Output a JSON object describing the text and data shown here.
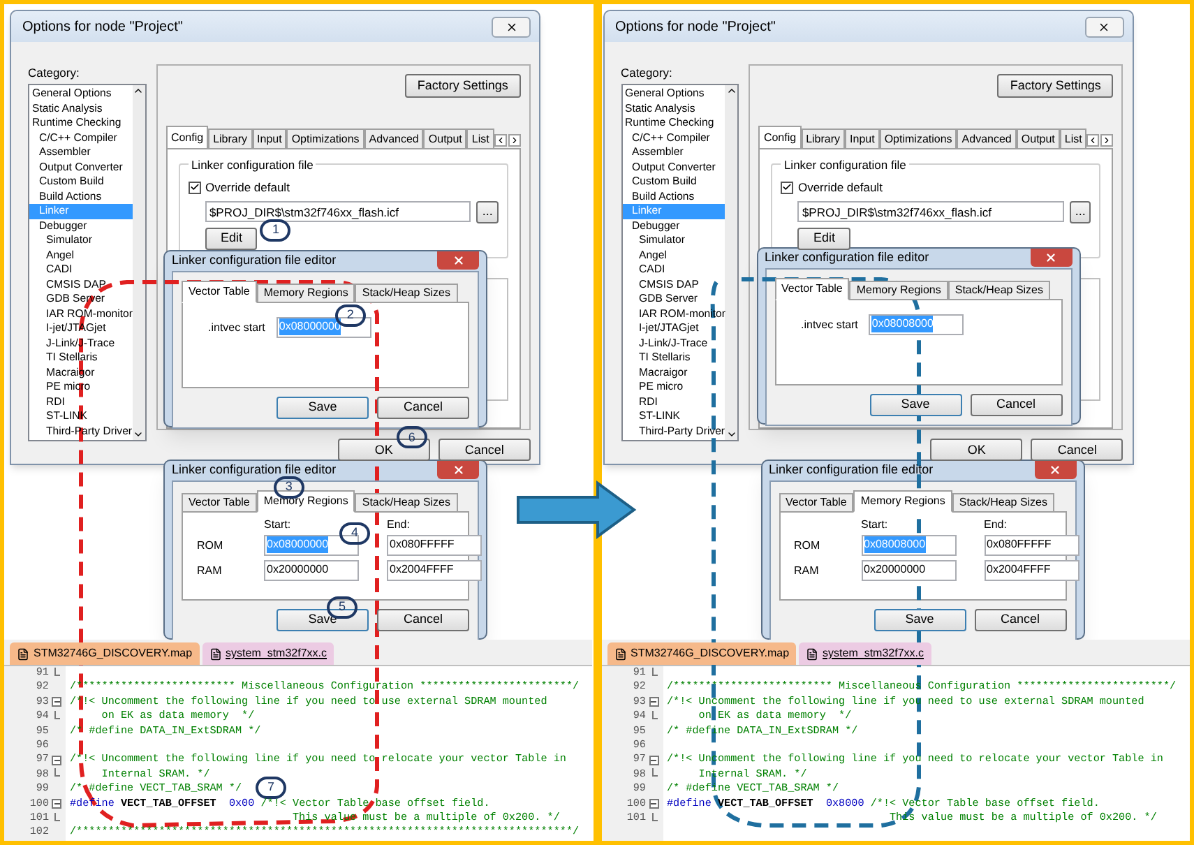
{
  "panels": [
    {
      "options_dialog": {
        "title": "Options for node \"Project\"",
        "category_label": "Category:",
        "categories": [
          {
            "label": "General Options",
            "selected": false
          },
          {
            "label": "Static Analysis",
            "selected": false
          },
          {
            "label": "Runtime Checking",
            "selected": false,
            "children": [
              {
                "label": "C/C++ Compiler",
                "selected": false
              },
              {
                "label": "Assembler",
                "selected": false
              },
              {
                "label": "Output Converter",
                "selected": false
              },
              {
                "label": "Custom Build",
                "selected": false
              },
              {
                "label": "Build Actions",
                "selected": false
              },
              {
                "label": "Linker",
                "selected": true
              },
              {
                "label": "Debugger",
                "selected": false,
                "children": [
                  {
                    "label": "Simulator",
                    "selected": false
                  },
                  {
                    "label": "Angel",
                    "selected": false
                  },
                  {
                    "label": "CADI",
                    "selected": false
                  },
                  {
                    "label": "CMSIS DAP",
                    "selected": false
                  },
                  {
                    "label": "GDB Server",
                    "selected": false
                  },
                  {
                    "label": "IAR ROM-monitor",
                    "selected": false
                  },
                  {
                    "label": "I-jet/JTAGjet",
                    "selected": false
                  },
                  {
                    "label": "J-Link/J-Trace",
                    "selected": false
                  },
                  {
                    "label": "TI Stellaris",
                    "selected": false
                  },
                  {
                    "label": "Macraigor",
                    "selected": false
                  },
                  {
                    "label": "PE micro",
                    "selected": false
                  },
                  {
                    "label": "RDI",
                    "selected": false
                  },
                  {
                    "label": "ST-LINK",
                    "selected": false
                  },
                  {
                    "label": "Third-Party Driver",
                    "selected": false
                  }
                ]
              }
            ]
          }
        ],
        "factory_button": "Factory Settings",
        "tabs": [
          {
            "label": "Config",
            "selected": true
          },
          {
            "label": "Library",
            "selected": false
          },
          {
            "label": "Input",
            "selected": false
          },
          {
            "label": "Optimizations",
            "selected": false
          },
          {
            "label": "Advanced",
            "selected": false
          },
          {
            "label": "Output",
            "selected": false
          },
          {
            "label": "List",
            "selected": false
          }
        ],
        "group_label": "Linker configuration file",
        "override": {
          "label": "Override default",
          "checked": true
        },
        "path": "$PROJ_DIR$\\stm32f746xx_flash.icf",
        "browse_button": "...",
        "edit_button": {
          "label": "Edit",
          "callout": "1"
        },
        "ok_button": {
          "label": "OK",
          "callout": "6"
        },
        "cancel_button": {
          "label": "Cancel"
        }
      },
      "vector_editor": {
        "title": "Linker configuration file editor",
        "tabs": [
          {
            "label": "Vector Table",
            "selected": true
          },
          {
            "label": "Memory Regions",
            "selected": false
          },
          {
            "label": "Stack/Heap Sizes",
            "selected": false
          }
        ],
        "field": {
          "label": ".intvec start",
          "value": "0x08000000",
          "highlighted": true,
          "callout": "2"
        },
        "save_button": {
          "label": "Save"
        },
        "cancel_button": {
          "label": "Cancel"
        }
      },
      "memory_editor": {
        "title": "Linker configuration file editor",
        "tabs": [
          {
            "label": "Vector Table",
            "selected": false
          },
          {
            "label": "Memory Regions",
            "selected": true,
            "callout": "3"
          },
          {
            "label": "Stack/Heap Sizes",
            "selected": false
          }
        ],
        "start_label": "Start:",
        "end_label": "End:",
        "rows": [
          {
            "label": "ROM",
            "start": {
              "value": "0x08000000",
              "highlighted": true,
              "callout": "4"
            },
            "end": {
              "value": "0x080FFFFF",
              "highlighted": false
            }
          },
          {
            "label": "RAM",
            "start": {
              "value": "0x20000000",
              "highlighted": false
            },
            "end": {
              "value": "0x2004FFFF",
              "highlighted": false
            }
          }
        ],
        "save_button": {
          "label": "Save",
          "callout": "5"
        },
        "cancel_button": {
          "label": "Cancel"
        }
      },
      "code_editor": {
        "tabs": [
          {
            "label": "STM32746G_DISCOVERY.map",
            "selected": false
          },
          {
            "label": "system_stm32f7xx.c",
            "selected": true
          }
        ],
        "lines": [
          {
            "number": "91",
            "kind": "end"
          },
          {
            "number": "92",
            "kind": "plain",
            "segments": [
              {
                "kind": "comment",
                "text": "/************************* Miscellaneous Configuration ************************/"
              }
            ]
          },
          {
            "number": "93",
            "kind": "start",
            "segments": [
              {
                "kind": "comment",
                "text": "/*!< Uncomment the following line if you need to use external SDRAM mounted"
              }
            ]
          },
          {
            "number": "94",
            "kind": "end",
            "segments": [
              {
                "kind": "comment",
                "text": "     on EK as data memory  */"
              }
            ]
          },
          {
            "number": "95",
            "kind": "plain",
            "segments": [
              {
                "kind": "comment",
                "text": "/* #define DATA_IN_ExtSDRAM */"
              }
            ]
          },
          {
            "number": "96",
            "kind": "plain"
          },
          {
            "number": "97",
            "kind": "start",
            "segments": [
              {
                "kind": "comment",
                "text": "/*!< Uncomment the following line if you need to relocate your vector Table in"
              }
            ]
          },
          {
            "number": "98",
            "kind": "end",
            "segments": [
              {
                "kind": "comment",
                "text": "     Internal SRAM. */"
              }
            ]
          },
          {
            "number": "99",
            "kind": "plain",
            "callout": "7",
            "segments": [
              {
                "kind": "comment",
                "text": "/* #define VECT_TAB_SRAM */"
              }
            ]
          },
          {
            "number": "100",
            "kind": "start",
            "segments": [
              {
                "kind": "keyword",
                "text": "#define"
              },
              {
                "kind": "plain",
                "text": " VECT_TAB_OFFSET  "
              },
              {
                "kind": "number",
                "text": "0x00"
              },
              {
                "kind": "comment",
                "text": " /*!< Vector Table base offset field."
              }
            ]
          },
          {
            "number": "101",
            "kind": "end",
            "segments": [
              {
                "kind": "comment",
                "text": "                                   This value must be a multiple of 0x200. */"
              }
            ]
          },
          {
            "number": "102",
            "kind": "plain",
            "segments": [
              {
                "kind": "comment",
                "text": "/******************************************************************************/"
              }
            ]
          }
        ]
      }
    },
    {
      "options_dialog": {
        "title": "Options for node \"Project\"",
        "category_label": "Category:",
        "categories": [
          {
            "label": "General Options",
            "selected": false
          },
          {
            "label": "Static Analysis",
            "selected": false
          },
          {
            "label": "Runtime Checking",
            "selected": false,
            "children": [
              {
                "label": "C/C++ Compiler",
                "selected": false
              },
              {
                "label": "Assembler",
                "selected": false
              },
              {
                "label": "Output Converter",
                "selected": false
              },
              {
                "label": "Custom Build",
                "selected": false
              },
              {
                "label": "Build Actions",
                "selected": false
              },
              {
                "label": "Linker",
                "selected": true
              },
              {
                "label": "Debugger",
                "selected": false,
                "children": [
                  {
                    "label": "Simulator",
                    "selected": false
                  },
                  {
                    "label": "Angel",
                    "selected": false
                  },
                  {
                    "label": "CADI",
                    "selected": false
                  },
                  {
                    "label": "CMSIS DAP",
                    "selected": false
                  },
                  {
                    "label": "GDB Server",
                    "selected": false
                  },
                  {
                    "label": "IAR ROM-monitor",
                    "selected": false
                  },
                  {
                    "label": "I-jet/JTAGjet",
                    "selected": false
                  },
                  {
                    "label": "J-Link/J-Trace",
                    "selected": false
                  },
                  {
                    "label": "TI Stellaris",
                    "selected": false
                  },
                  {
                    "label": "Macraigor",
                    "selected": false
                  },
                  {
                    "label": "PE micro",
                    "selected": false
                  },
                  {
                    "label": "RDI",
                    "selected": false
                  },
                  {
                    "label": "ST-LINK",
                    "selected": false
                  },
                  {
                    "label": "Third-Party Driver",
                    "selected": false
                  }
                ]
              }
            ]
          }
        ],
        "factory_button": "Factory Settings",
        "tabs": [
          {
            "label": "Config",
            "selected": true
          },
          {
            "label": "Library",
            "selected": false
          },
          {
            "label": "Input",
            "selected": false
          },
          {
            "label": "Optimizations",
            "selected": false
          },
          {
            "label": "Advanced",
            "selected": false
          },
          {
            "label": "Output",
            "selected": false
          },
          {
            "label": "List",
            "selected": false
          }
        ],
        "group_label": "Linker configuration file",
        "override": {
          "label": "Override default",
          "checked": true
        },
        "path": "$PROJ_DIR$\\stm32f746xx_flash.icf",
        "browse_button": "...",
        "edit_button": {
          "label": "Edit"
        },
        "ok_button": {
          "label": "OK"
        },
        "cancel_button": {
          "label": "Cancel"
        }
      },
      "vector_editor": {
        "title": "Linker configuration file editor",
        "tabs": [
          {
            "label": "Vector Table",
            "selected": true
          },
          {
            "label": "Memory Regions",
            "selected": false
          },
          {
            "label": "Stack/Heap Sizes",
            "selected": false
          }
        ],
        "field": {
          "label": ".intvec start",
          "value": "0x08008000",
          "highlighted": true
        },
        "save_button": {
          "label": "Save"
        },
        "cancel_button": {
          "label": "Cancel"
        }
      },
      "memory_editor": {
        "title": "Linker configuration file editor",
        "tabs": [
          {
            "label": "Vector Table",
            "selected": false
          },
          {
            "label": "Memory Regions",
            "selected": true
          },
          {
            "label": "Stack/Heap Sizes",
            "selected": false
          }
        ],
        "start_label": "Start:",
        "end_label": "End:",
        "rows": [
          {
            "label": "ROM",
            "start": {
              "value": "0x08008000",
              "highlighted": true
            },
            "end": {
              "value": "0x080FFFFF",
              "highlighted": false
            }
          },
          {
            "label": "RAM",
            "start": {
              "value": "0x20000000",
              "highlighted": false
            },
            "end": {
              "value": "0x2004FFFF",
              "highlighted": false
            }
          }
        ],
        "save_button": {
          "label": "Save"
        },
        "cancel_button": {
          "label": "Cancel"
        }
      },
      "code_editor": {
        "tabs": [
          {
            "label": "STM32746G_DISCOVERY.map",
            "selected": false
          },
          {
            "label": "system_stm32f7xx.c",
            "selected": true
          }
        ],
        "lines": [
          {
            "number": "91",
            "kind": "end"
          },
          {
            "number": "92",
            "kind": "plain",
            "segments": [
              {
                "kind": "comment",
                "text": "/************************* Miscellaneous Configuration ************************/"
              }
            ]
          },
          {
            "number": "93",
            "kind": "start",
            "segments": [
              {
                "kind": "comment",
                "text": "/*!< Uncomment the following line if you need to use external SDRAM mounted"
              }
            ]
          },
          {
            "number": "94",
            "kind": "end",
            "segments": [
              {
                "kind": "comment",
                "text": "     on EK as data memory  */"
              }
            ]
          },
          {
            "number": "95",
            "kind": "plain",
            "segments": [
              {
                "kind": "comment",
                "text": "/* #define DATA_IN_ExtSDRAM */"
              }
            ]
          },
          {
            "number": "96",
            "kind": "plain"
          },
          {
            "number": "97",
            "kind": "start",
            "segments": [
              {
                "kind": "comment",
                "text": "/*!< Uncomment the following line if you need to relocate your vector Table in"
              }
            ]
          },
          {
            "number": "98",
            "kind": "end",
            "segments": [
              {
                "kind": "comment",
                "text": "     Internal SRAM. */"
              }
            ]
          },
          {
            "number": "99",
            "kind": "plain",
            "segments": [
              {
                "kind": "comment",
                "text": "/* #define VECT_TAB_SRAM */"
              }
            ]
          },
          {
            "number": "100",
            "kind": "start",
            "segments": [
              {
                "kind": "keyword",
                "text": "#define"
              },
              {
                "kind": "plain",
                "text": " VECT_TAB_OFFSET  "
              },
              {
                "kind": "number",
                "text": "0x8000"
              },
              {
                "kind": "comment",
                "text": " /*!< Vector Table base offset field."
              }
            ]
          },
          {
            "number": "101",
            "kind": "end",
            "segments": [
              {
                "kind": "comment",
                "text": "                                   This value must be a multiple of 0x200. */"
              }
            ]
          }
        ]
      }
    }
  ]
}
